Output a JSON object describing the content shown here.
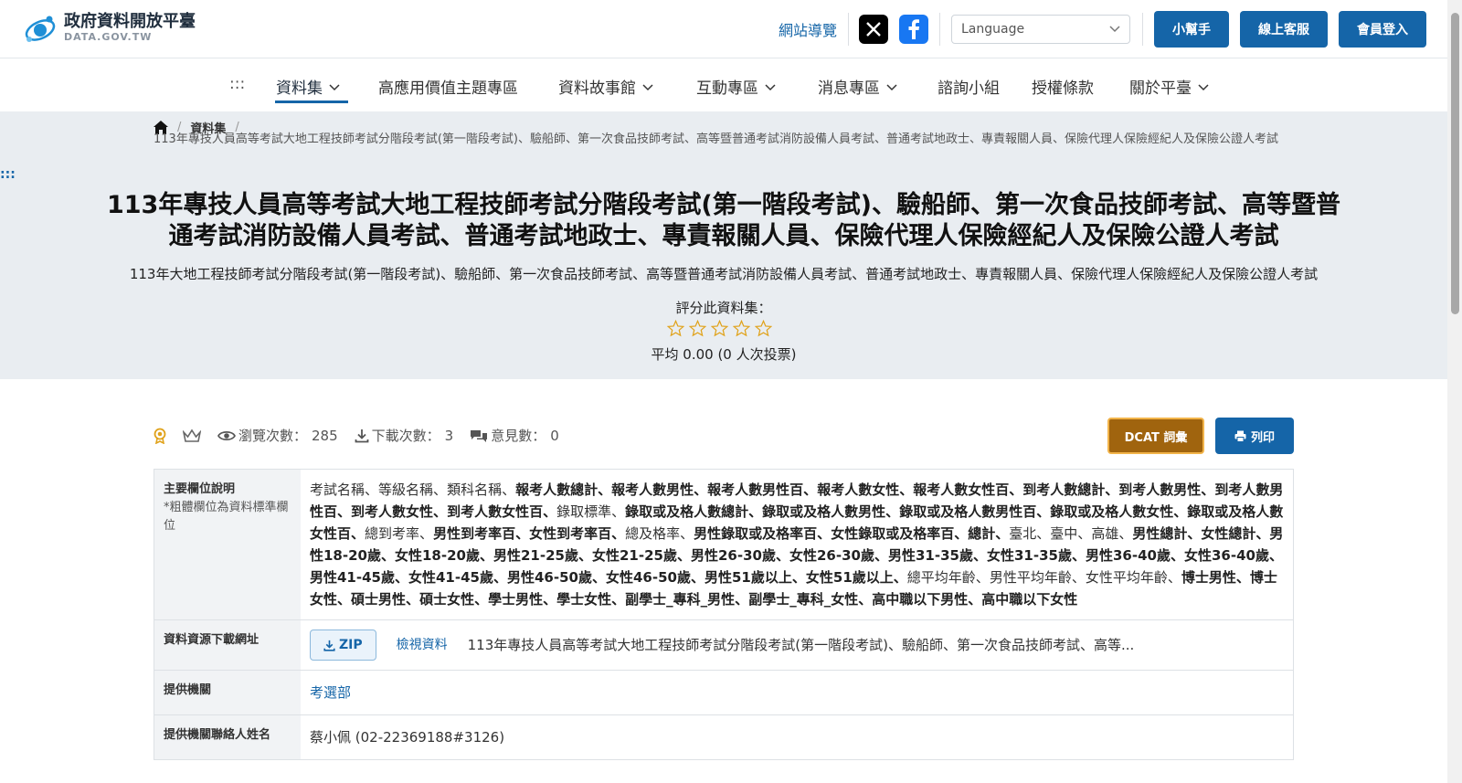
{
  "header": {
    "logo_title": "政府資料開放平臺",
    "logo_subtitle": "DATA.GOV.TW",
    "sitemap": "網站導覽",
    "language_placeholder": "Language",
    "buttons": {
      "helper": "小幫手",
      "support": "線上客服",
      "login": "會員登入"
    }
  },
  "nav": {
    "skip": ":::",
    "items": [
      {
        "label": "資料集",
        "dropdown": true
      },
      {
        "label": "高應用價值主題專區",
        "dropdown": false
      },
      {
        "label": "資料故事館",
        "dropdown": true
      },
      {
        "label": "互動專區",
        "dropdown": true
      },
      {
        "label": "消息專區",
        "dropdown": true
      },
      {
        "label": "諮詢小組",
        "dropdown": false
      },
      {
        "label": "授權條款",
        "dropdown": false
      },
      {
        "label": "關於平臺",
        "dropdown": true
      }
    ]
  },
  "breadcrumb": {
    "crumb_1": "資料集",
    "current": "113年專技人員高等考試大地工程技師考試分階段考試(第一階段考試)、驗船師、第一次食品技師考試、高等暨普通考試消防設備人員考試、普通考試地政士、專責報關人員、保險代理人保險經紀人及保險公證人考試"
  },
  "skip_left": ":::",
  "dataset": {
    "title": "113年專技人員高等考試大地工程技師考試分階段考試(第一階段考試)、驗船師、第一次食品技師考試、高等暨普通考試消防設備人員考試、普通考試地政士、專責報關人員、保險代理人保險經紀人及保險公證人考試",
    "description": "113年大地工程技師考試分階段考試(第一階段考試)、驗船師、第一次食品技師考試、高等暨普通考試消防設備人員考試、普通考試地政士、專責報關人員、保險代理人保險經紀人及保險公證人考試",
    "rate_label": "評分此資料集：",
    "rating_average": "平均 0.00 (0 人次投票)",
    "stars_filled": 0
  },
  "stats": {
    "views_label": "瀏覽次數：",
    "views": "285",
    "downloads_label": "下載次數：",
    "downloads": "3",
    "comments_label": "意見數：",
    "comments": "0"
  },
  "actions": {
    "dcat": "DCAT 詞彙",
    "print": "列印"
  },
  "table": {
    "fields_header": "主要欄位說明",
    "fields_note": "*粗體欄位為資料標準欄位",
    "fields": [
      {
        "t": "考試名稱",
        "b": false
      },
      {
        "t": "等級名稱",
        "b": false
      },
      {
        "t": "類科名稱",
        "b": false
      },
      {
        "t": "報考人數總計",
        "b": true
      },
      {
        "t": "報考人數男性",
        "b": true
      },
      {
        "t": "報考人數男性百",
        "b": true
      },
      {
        "t": "報考人數女性",
        "b": true
      },
      {
        "t": "報考人數女性百",
        "b": true
      },
      {
        "t": "到考人數總計",
        "b": true
      },
      {
        "t": "到考人數男性",
        "b": true
      },
      {
        "t": "到考人數男性百",
        "b": true
      },
      {
        "t": "到考人數女性",
        "b": true
      },
      {
        "t": "到考人數女性百",
        "b": true
      },
      {
        "t": "錄取標準",
        "b": false
      },
      {
        "t": "錄取或及格人數總計",
        "b": true
      },
      {
        "t": "錄取或及格人數男性",
        "b": true
      },
      {
        "t": "錄取或及格人數男性百",
        "b": true
      },
      {
        "t": "錄取或及格人數女性",
        "b": true
      },
      {
        "t": "錄取或及格人數女性百",
        "b": true
      },
      {
        "t": "總到考率",
        "b": false
      },
      {
        "t": "男性到考率百",
        "b": true
      },
      {
        "t": "女性到考率百",
        "b": true
      },
      {
        "t": "總及格率",
        "b": false
      },
      {
        "t": "男性錄取或及格率百",
        "b": true
      },
      {
        "t": "女性錄取或及格率百",
        "b": true
      },
      {
        "t": "總計",
        "b": true
      },
      {
        "t": "臺北",
        "b": false
      },
      {
        "t": "臺中",
        "b": false
      },
      {
        "t": "高雄",
        "b": false
      },
      {
        "t": "男性總計",
        "b": true
      },
      {
        "t": "女性總計",
        "b": true
      },
      {
        "t": "男性18-20歲",
        "b": true
      },
      {
        "t": "女性18-20歲",
        "b": true
      },
      {
        "t": "男性21-25歲",
        "b": true
      },
      {
        "t": "女性21-25歲",
        "b": true
      },
      {
        "t": "男性26-30歲",
        "b": true
      },
      {
        "t": "女性26-30歲",
        "b": true
      },
      {
        "t": "男性31-35歲",
        "b": true
      },
      {
        "t": "女性31-35歲",
        "b": true
      },
      {
        "t": "男性36-40歲",
        "b": true
      },
      {
        "t": "女性36-40歲",
        "b": true
      },
      {
        "t": "男性41-45歲",
        "b": true
      },
      {
        "t": "女性41-45歲",
        "b": true
      },
      {
        "t": "男性46-50歲",
        "b": true
      },
      {
        "t": "女性46-50歲",
        "b": true
      },
      {
        "t": "男性51歲以上",
        "b": true
      },
      {
        "t": "女性51歲以上",
        "b": true
      },
      {
        "t": "總平均年齡",
        "b": false
      },
      {
        "t": "男性平均年齡",
        "b": false
      },
      {
        "t": "女性平均年齡",
        "b": false
      },
      {
        "t": "博士男性",
        "b": true
      },
      {
        "t": "博士女性",
        "b": true
      },
      {
        "t": "碩士男性",
        "b": true
      },
      {
        "t": "碩士女性",
        "b": true
      },
      {
        "t": "學士男性",
        "b": true
      },
      {
        "t": "學士女性",
        "b": true
      },
      {
        "t": "副學士_專科_男性",
        "b": true
      },
      {
        "t": "副學士_專科_女性",
        "b": true
      },
      {
        "t": "高中職以下男性",
        "b": true
      },
      {
        "t": "高中職以下女性",
        "b": true
      }
    ],
    "resource_header": "資料資源下載網址",
    "zip_label": "ZIP",
    "view_label": "檢視資料",
    "resource_name": "113年專技人員高等考試大地工程技師考試分階段考試(第一階段考試)、驗船師、第一次食品技師考試、高等...",
    "provider_header": "提供機關",
    "provider": "考選部",
    "contact_header": "提供機關聯絡人姓名",
    "contact": "蔡小佩 (02-22369188#3126)"
  }
}
